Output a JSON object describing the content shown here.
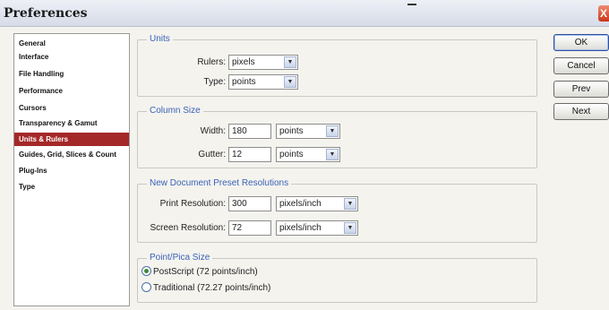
{
  "window": {
    "title": "Preferences",
    "close_glyph": "X"
  },
  "sidebar": {
    "items": [
      {
        "label": "General"
      },
      {
        "label": "Interface"
      },
      {
        "label": "File Handling"
      },
      {
        "label": "Performance"
      },
      {
        "label": "Cursors"
      },
      {
        "label": "Transparency & Gamut"
      },
      {
        "label": "Units & Rulers",
        "selected": true
      },
      {
        "label": "Guides, Grid, Slices & Count"
      },
      {
        "label": "Plug-Ins"
      },
      {
        "label": "Type"
      }
    ]
  },
  "units": {
    "legend": "Units",
    "rulers_label": "Rulers:",
    "rulers_value": "pixels",
    "type_label": "Type:",
    "type_value": "points"
  },
  "column_size": {
    "legend": "Column Size",
    "width_label": "Width:",
    "width_value": "180",
    "width_unit": "points",
    "gutter_label": "Gutter:",
    "gutter_value": "12",
    "gutter_unit": "points"
  },
  "preset_resolutions": {
    "legend": "New Document Preset Resolutions",
    "print_label": "Print Resolution:",
    "print_value": "300",
    "print_unit": "pixels/inch",
    "screen_label": "Screen Resolution:",
    "screen_value": "72",
    "screen_unit": "pixels/inch"
  },
  "point_pica": {
    "legend": "Point/Pica Size",
    "postscript_label": "PostScript (72 points/inch)",
    "traditional_label": "Traditional (72.27 points/inch)",
    "selected": "postscript"
  },
  "buttons": {
    "ok": "OK",
    "cancel": "Cancel",
    "prev": "Prev",
    "next": "Next"
  },
  "dropdown_glyph": "▼"
}
